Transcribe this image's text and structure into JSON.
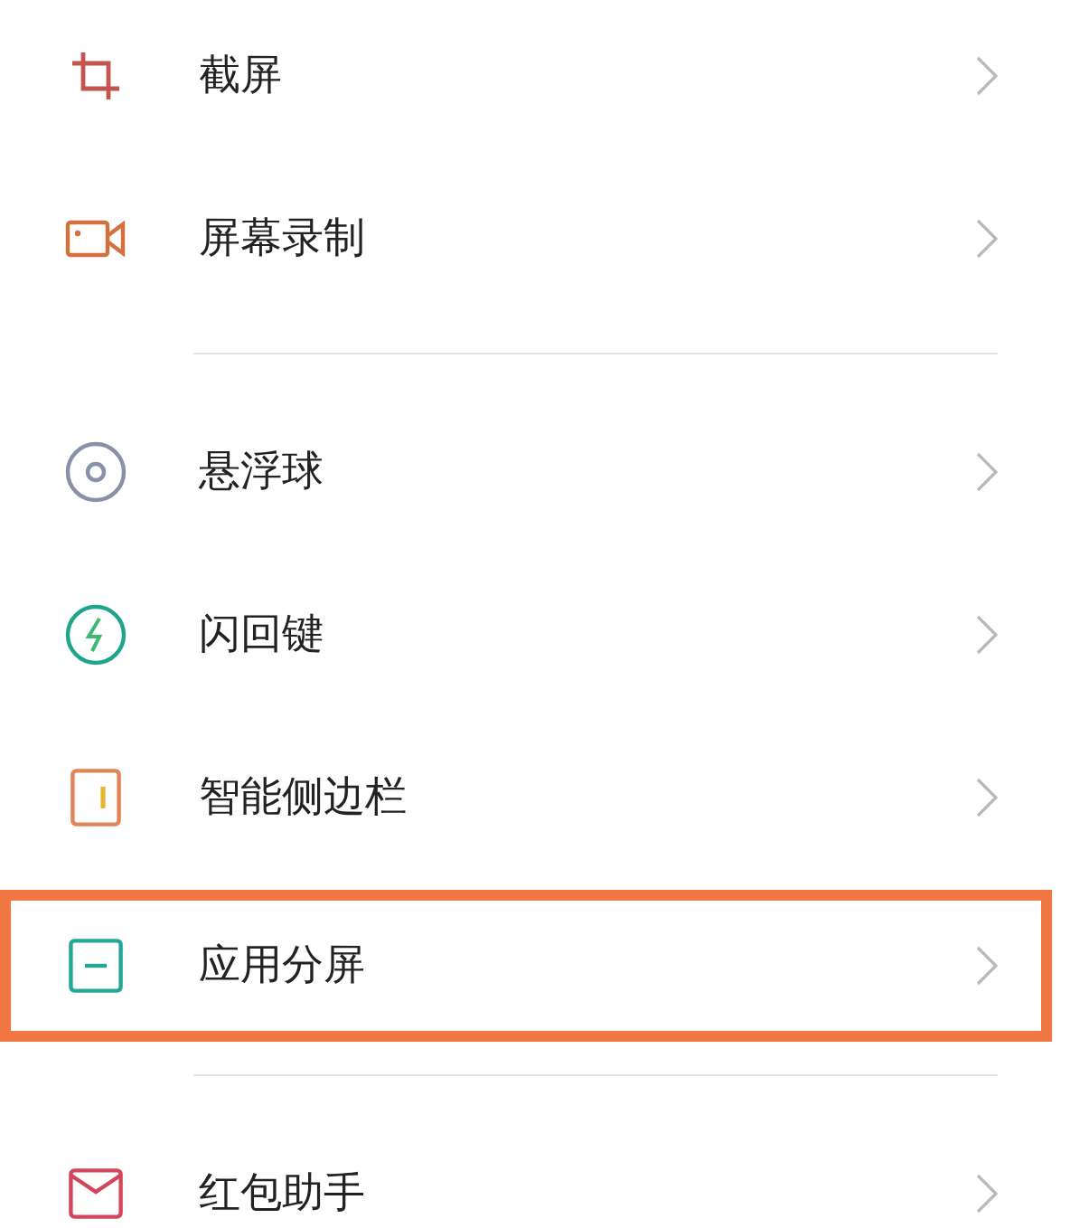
{
  "groups": [
    {
      "items": [
        {
          "kind": "crop",
          "label": "截屏",
          "highlighted": false
        },
        {
          "kind": "record",
          "label": "屏幕录制",
          "highlighted": false
        }
      ]
    },
    {
      "items": [
        {
          "kind": "ball",
          "label": "悬浮球",
          "highlighted": false
        },
        {
          "kind": "flash",
          "label": "闪回键",
          "highlighted": false
        },
        {
          "kind": "sidebar",
          "label": "智能侧边栏",
          "highlighted": false
        },
        {
          "kind": "split",
          "label": "应用分屏",
          "highlighted": true
        }
      ]
    },
    {
      "items": [
        {
          "kind": "envelope",
          "label": "红包助手",
          "highlighted": false
        }
      ]
    }
  ]
}
